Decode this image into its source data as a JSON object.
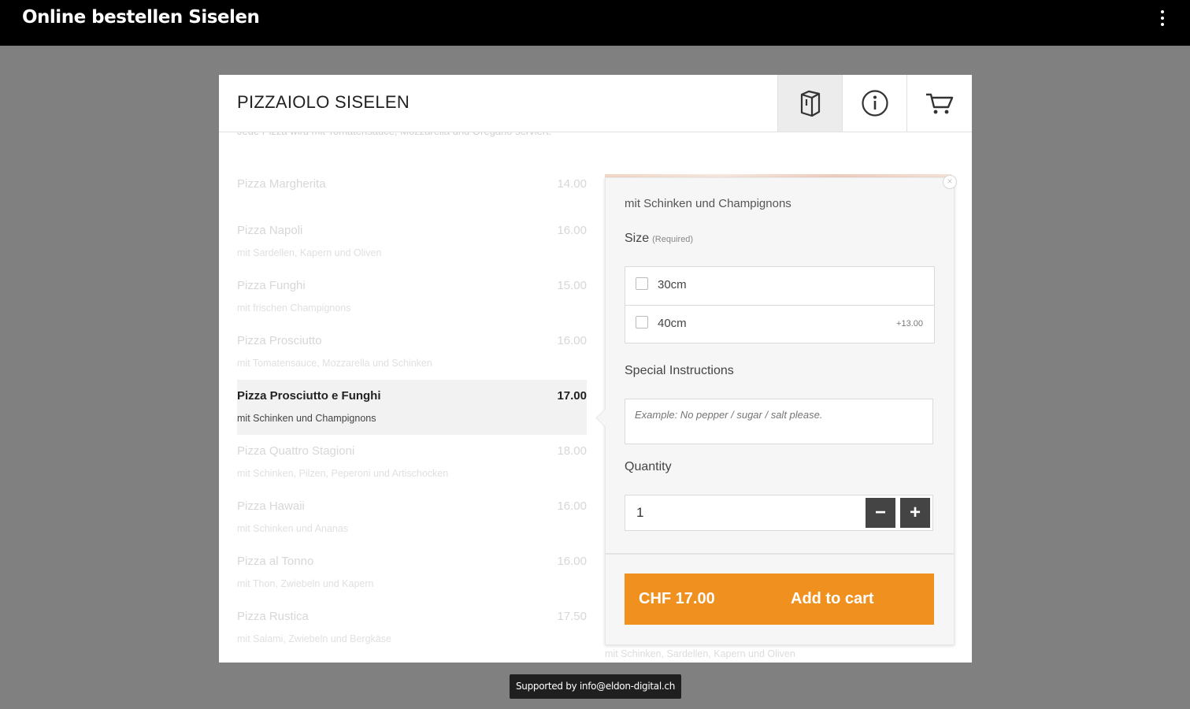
{
  "app": {
    "title": "Online bestellen Siselen"
  },
  "header": {
    "restaurant_name": "PIZZAIOLO SISELEN"
  },
  "intro_text": "Jede Pizza wird mit Tomatensauce, Mozzarella und Oregano serviert.",
  "menu": [
    {
      "name": "Pizza Margherita",
      "price": "14.00",
      "desc": ""
    },
    {
      "name": "Pizza Napoli",
      "price": "16.00",
      "desc": "mit Sardellen, Kapern und Oliven"
    },
    {
      "name": "Pizza Funghi",
      "price": "15.00",
      "desc": "mit frischen Champignons"
    },
    {
      "name": "Pizza Prosciutto",
      "price": "16.00",
      "desc": "mit Tomatensauce, Mozzarella und Schinken"
    },
    {
      "name": "Pizza Prosciutto e Funghi",
      "price": "17.00",
      "desc": "mit Schinken und Champignons"
    },
    {
      "name": "Pizza Quattro Stagioni",
      "price": "18.00",
      "desc": "mit Schinken, Pilzen, Peperoni und Artischocken"
    },
    {
      "name": "Pizza Hawaii",
      "price": "16.00",
      "desc": "mit Schinken und Ananas"
    },
    {
      "name": "Pizza al Tonno",
      "price": "16.00",
      "desc": "mit Thon, Zwiebeln und Kapern"
    },
    {
      "name": "Pizza Rustica",
      "price": "17.50",
      "desc": "mit Salami, Zwiebeln und Bergkäse"
    }
  ],
  "popup": {
    "close": "×",
    "item_desc": "mit Schinken und Champignons",
    "size_label": "Size",
    "size_required": "(Required)",
    "options": [
      {
        "label": "30cm",
        "extra": ""
      },
      {
        "label": "40cm",
        "extra": "+13.00"
      }
    ],
    "instructions_label": "Special Instructions",
    "instructions_placeholder": "Example: No pepper / sugar / salt please.",
    "quantity_label": "Quantity",
    "quantity_value": "1",
    "minus": "−",
    "plus": "+",
    "total": "CHF 17.00",
    "add_to_cart": "Add to cart"
  },
  "below_text": "mit Schinken, Sardellen, Kapern und Oliven",
  "footer": {
    "supported_by": "Supported by info@eldon-digital.ch"
  },
  "colors": {
    "accent": "#f0911f",
    "topbar": "#000000",
    "overlay": "#808080"
  },
  "icons": {
    "menu": "menu-book-icon",
    "info": "info-icon",
    "cart": "cart-icon",
    "more": "more-vert-icon"
  }
}
